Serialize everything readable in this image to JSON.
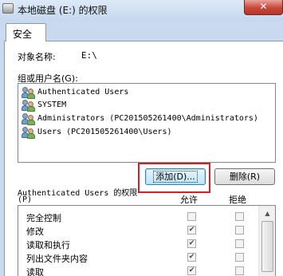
{
  "window": {
    "title": "本地磁盘 (E:) 的权限",
    "close_glyph": "✕",
    "accent": "#c8463a"
  },
  "tab": {
    "label": "安全"
  },
  "object": {
    "label": "对象名称:",
    "value": "E:\\"
  },
  "group": {
    "label": "组或用户名(G):",
    "items": [
      "Authenticated Users",
      "SYSTEM",
      "Administrators (PC201505261400\\Administrators)",
      "Users (PC201505261400\\Users)"
    ]
  },
  "buttons": {
    "add": "添加(D)...",
    "remove": "删除(R)"
  },
  "permissions": {
    "title": "Authenticated Users 的权限",
    "title_suffix": "(P)",
    "allow_header": "允许",
    "deny_header": "拒绝",
    "rows": [
      {
        "name": "完全控制",
        "allow": false,
        "deny": false
      },
      {
        "name": "修改",
        "allow": true,
        "deny": false
      },
      {
        "name": "读取和执行",
        "allow": true,
        "deny": false
      },
      {
        "name": "列出文件夹内容",
        "allow": true,
        "deny": false
      },
      {
        "name": "读取",
        "allow": true,
        "deny": false
      }
    ],
    "check_glyph": "✔"
  },
  "highlight_color": "#d31f26"
}
